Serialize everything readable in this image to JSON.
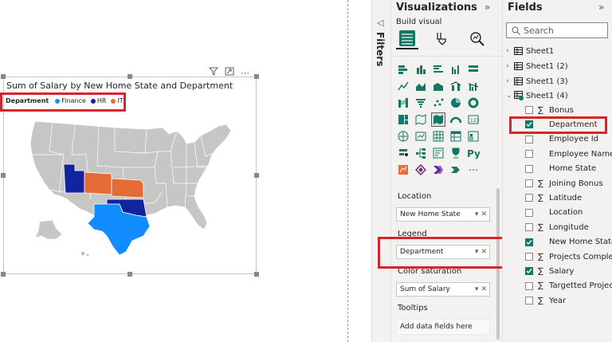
{
  "visual": {
    "title": "Sum of Salary by New Home State and Department",
    "legend": {
      "title": "Department",
      "entries": [
        {
          "label": "Finance",
          "color": "#118DFF"
        },
        {
          "label": "HR",
          "color": "#12239E"
        },
        {
          "label": "IT",
          "color": "#E66C37"
        }
      ]
    },
    "toolbar": {
      "filter_icon": "filter-icon",
      "focus_icon": "focus-mode-icon",
      "more": "⋯"
    },
    "map_colors": {
      "base": "#C8C6C4",
      "finance": "#118DFF",
      "hr": "#12239E",
      "it": "#E66C37",
      "border": "#ffffff"
    }
  },
  "filters": {
    "label": "Filters",
    "arrow": "◁"
  },
  "visualizations": {
    "title": "Visualizations",
    "collapse": "»",
    "build_visual": "Build visual",
    "more": "⋯",
    "location": {
      "label": "Location",
      "value": "New Home State"
    },
    "legend": {
      "label": "Legend",
      "value": "Department"
    },
    "color_saturation": {
      "label": "Color saturation",
      "value": "Sum of Salary"
    },
    "tooltips": {
      "label": "Tooltips",
      "placeholder": "Add data fields here"
    }
  },
  "fields": {
    "title": "Fields",
    "collapse": "»",
    "search_placeholder": "Search",
    "tables": [
      {
        "name": "Sheet1"
      },
      {
        "name": "Sheet1 (2)"
      },
      {
        "name": "Sheet1 (3)"
      },
      {
        "name": "Sheet1 (4)"
      }
    ],
    "sheet4_fields": [
      {
        "label": "Bonus",
        "sigma": true,
        "checked": false
      },
      {
        "label": "Department",
        "sigma": false,
        "checked": true
      },
      {
        "label": "Employee Id",
        "sigma": false,
        "checked": false
      },
      {
        "label": "Employee Name",
        "sigma": false,
        "checked": false
      },
      {
        "label": "Home State",
        "sigma": false,
        "checked": false
      },
      {
        "label": "Joining Bonus",
        "sigma": true,
        "checked": false
      },
      {
        "label": "Latitude",
        "sigma": true,
        "checked": false
      },
      {
        "label": "Location",
        "sigma": false,
        "checked": false
      },
      {
        "label": "Longitude",
        "sigma": true,
        "checked": false
      },
      {
        "label": "New Home State",
        "sigma": false,
        "checked": true
      },
      {
        "label": "Projects Complet...",
        "sigma": true,
        "checked": false
      },
      {
        "label": "Salary",
        "sigma": true,
        "checked": true
      },
      {
        "label": "Targetted Projects",
        "sigma": true,
        "checked": false
      },
      {
        "label": "Year",
        "sigma": true,
        "checked": false
      }
    ]
  }
}
